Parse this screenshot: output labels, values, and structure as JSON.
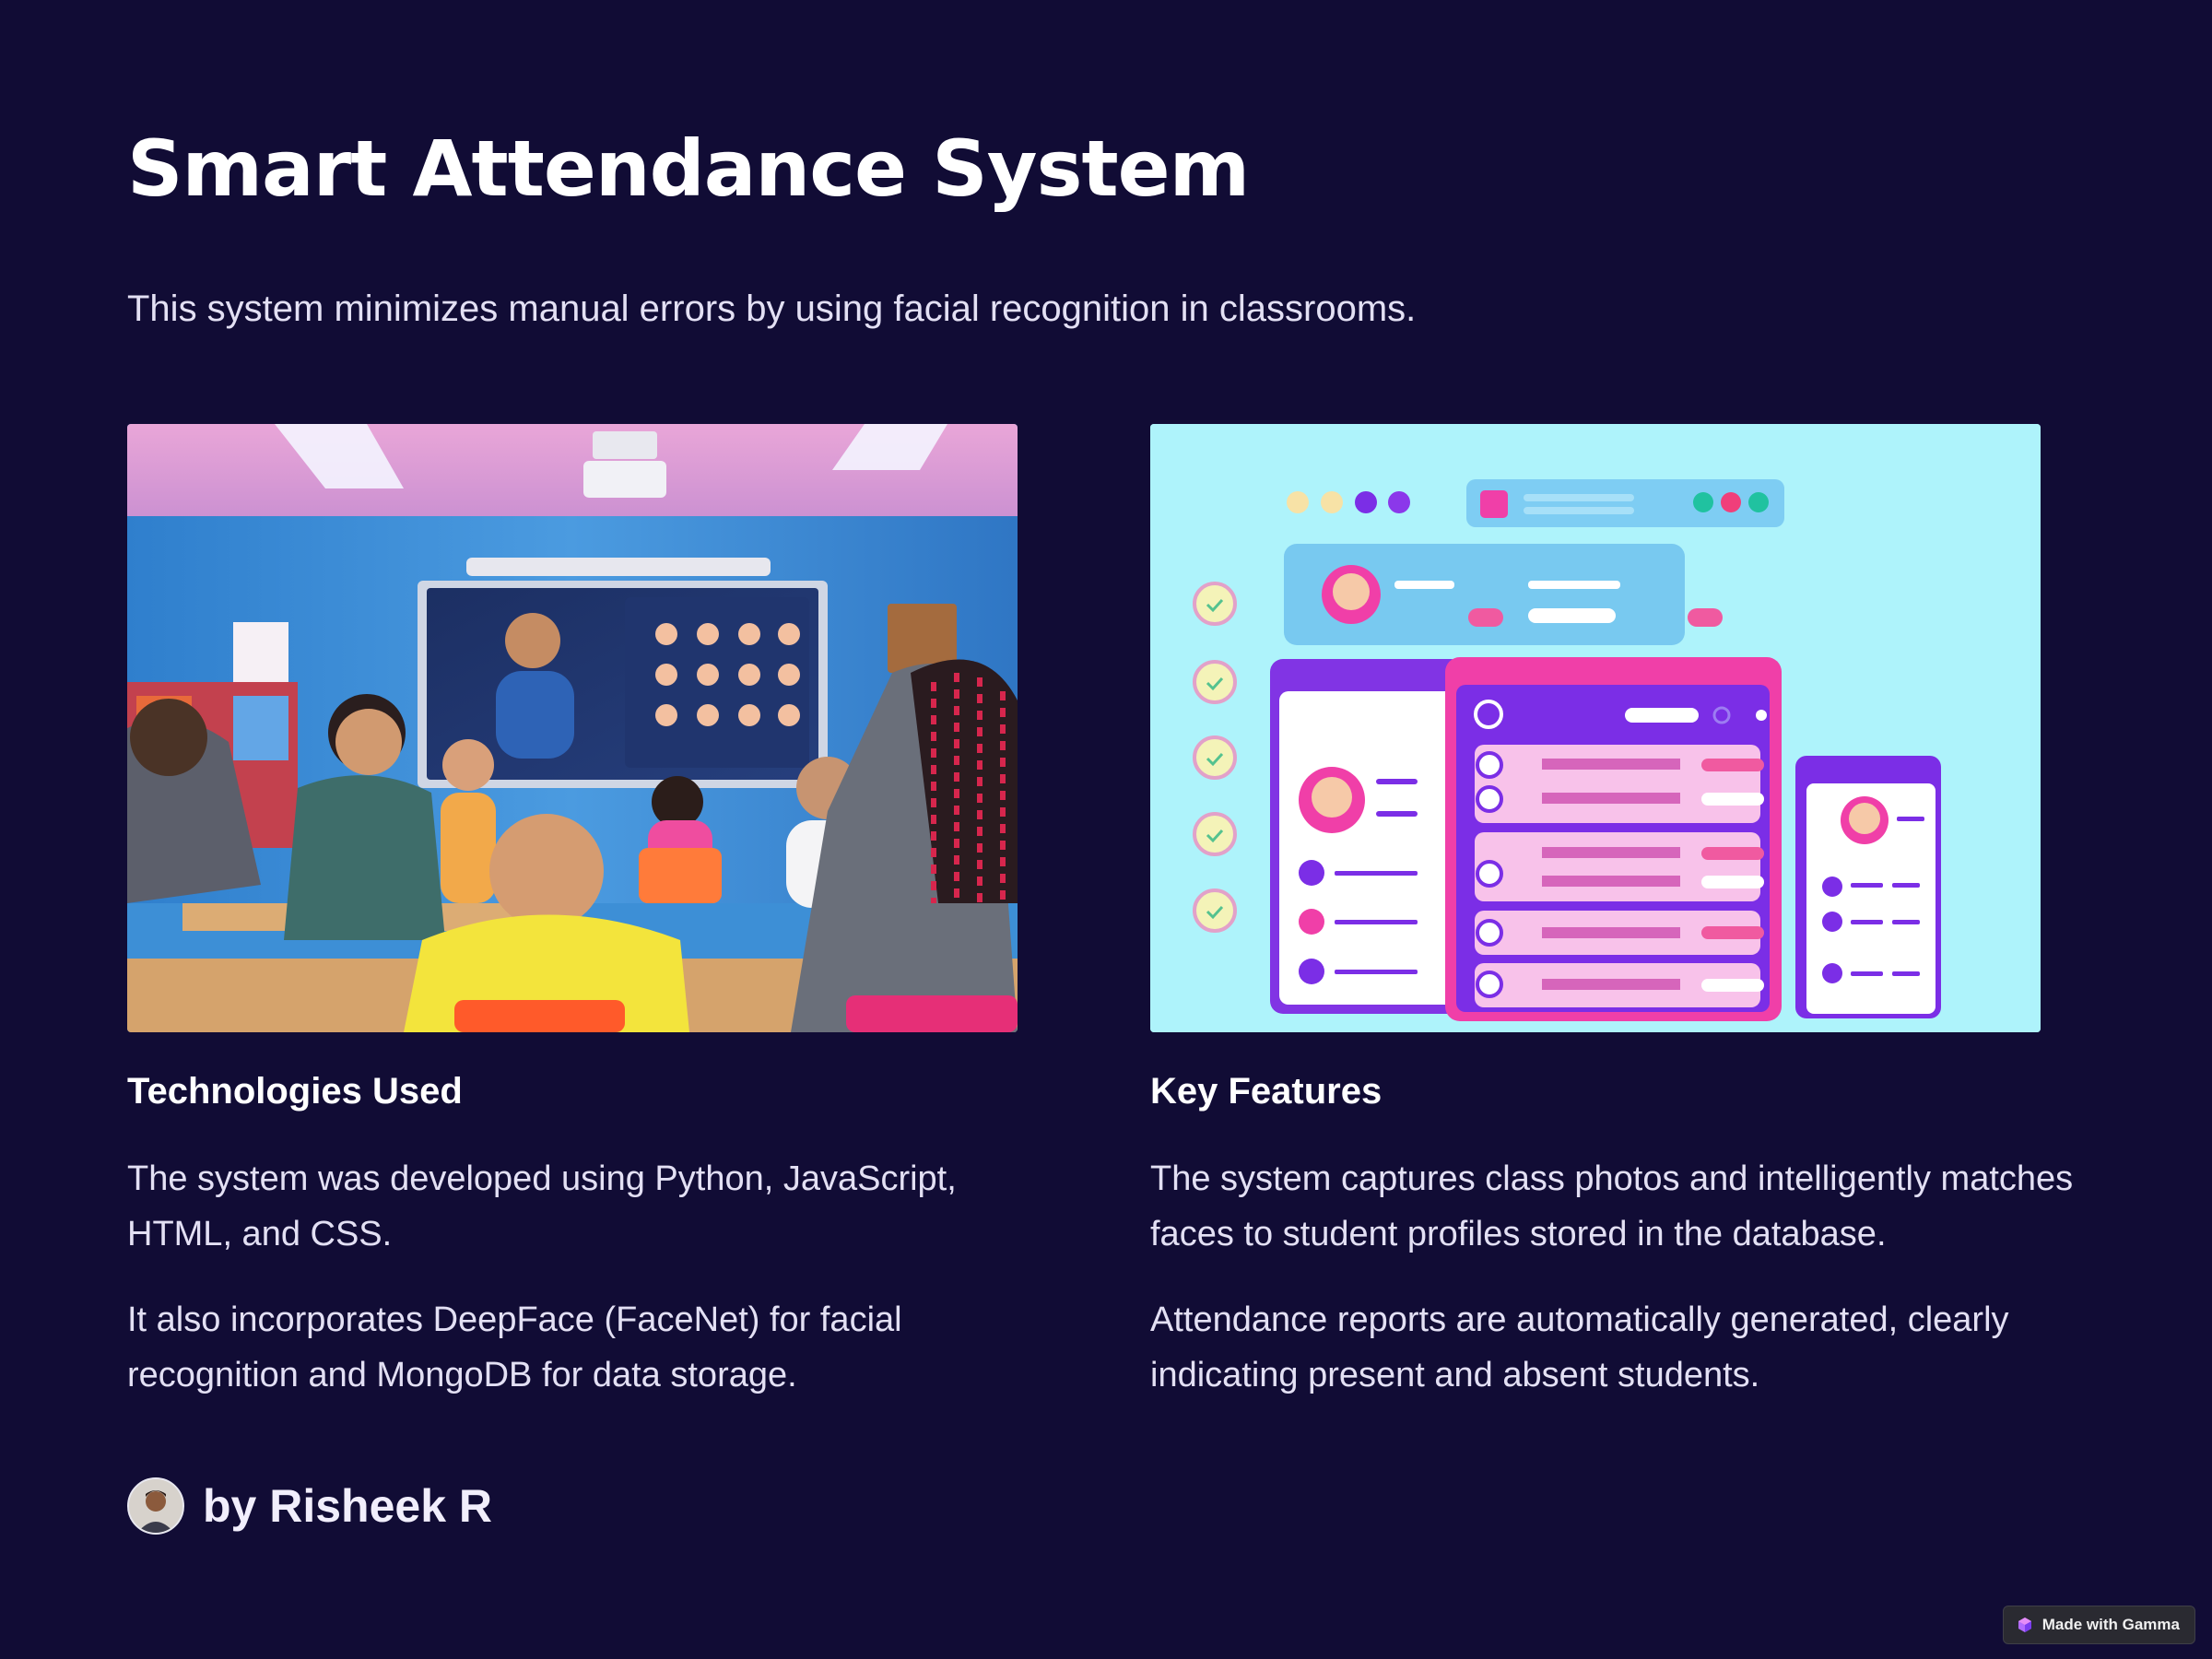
{
  "slide": {
    "title": "Smart Attendance System",
    "subtitle": "This system minimizes manual errors by using facial recognition in classrooms."
  },
  "left_column": {
    "image": "classroom-photo",
    "heading": "Technologies Used",
    "paragraphs": [
      "The system was developed using Python, JavaScript, HTML, and CSS.",
      "It also incorporates DeepFace (FaceNet) for facial recognition and MongoDB for data storage."
    ]
  },
  "right_column": {
    "image": "attendance-dashboard-illustration",
    "heading": "Key Features",
    "paragraphs": [
      "The system captures class photos and intelligently matches faces to student profiles stored in the database.",
      "Attendance reports are automatically generated, clearly indicating present and absent students."
    ]
  },
  "author": {
    "name": "by Risheek R",
    "avatar_icon": "user-avatar"
  },
  "badge": {
    "label": "Made with Gamma",
    "icon": "gamma-logo-icon"
  },
  "colors": {
    "background": "#110c35",
    "heading": "#ffffff",
    "body_text": "#e3e0f4",
    "illustration_bg": "#aef3fb",
    "accent_purple": "#7b2ee6",
    "accent_pink": "#f03fa8"
  }
}
